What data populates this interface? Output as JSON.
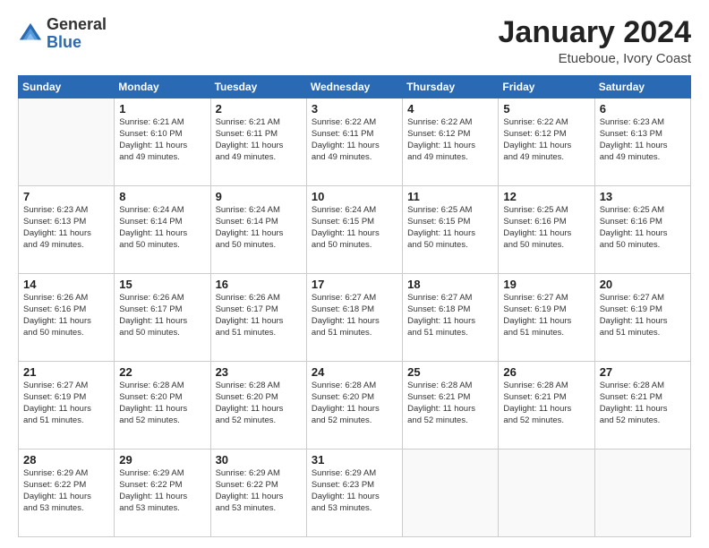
{
  "header": {
    "logo_general": "General",
    "logo_blue": "Blue",
    "month": "January 2024",
    "location": "Etueboue, Ivory Coast"
  },
  "weekdays": [
    "Sunday",
    "Monday",
    "Tuesday",
    "Wednesday",
    "Thursday",
    "Friday",
    "Saturday"
  ],
  "weeks": [
    [
      {
        "day": "",
        "info": ""
      },
      {
        "day": "1",
        "info": "Sunrise: 6:21 AM\nSunset: 6:10 PM\nDaylight: 11 hours\nand 49 minutes."
      },
      {
        "day": "2",
        "info": "Sunrise: 6:21 AM\nSunset: 6:11 PM\nDaylight: 11 hours\nand 49 minutes."
      },
      {
        "day": "3",
        "info": "Sunrise: 6:22 AM\nSunset: 6:11 PM\nDaylight: 11 hours\nand 49 minutes."
      },
      {
        "day": "4",
        "info": "Sunrise: 6:22 AM\nSunset: 6:12 PM\nDaylight: 11 hours\nand 49 minutes."
      },
      {
        "day": "5",
        "info": "Sunrise: 6:22 AM\nSunset: 6:12 PM\nDaylight: 11 hours\nand 49 minutes."
      },
      {
        "day": "6",
        "info": "Sunrise: 6:23 AM\nSunset: 6:13 PM\nDaylight: 11 hours\nand 49 minutes."
      }
    ],
    [
      {
        "day": "7",
        "info": "Sunrise: 6:23 AM\nSunset: 6:13 PM\nDaylight: 11 hours\nand 49 minutes."
      },
      {
        "day": "8",
        "info": "Sunrise: 6:24 AM\nSunset: 6:14 PM\nDaylight: 11 hours\nand 50 minutes."
      },
      {
        "day": "9",
        "info": "Sunrise: 6:24 AM\nSunset: 6:14 PM\nDaylight: 11 hours\nand 50 minutes."
      },
      {
        "day": "10",
        "info": "Sunrise: 6:24 AM\nSunset: 6:15 PM\nDaylight: 11 hours\nand 50 minutes."
      },
      {
        "day": "11",
        "info": "Sunrise: 6:25 AM\nSunset: 6:15 PM\nDaylight: 11 hours\nand 50 minutes."
      },
      {
        "day": "12",
        "info": "Sunrise: 6:25 AM\nSunset: 6:16 PM\nDaylight: 11 hours\nand 50 minutes."
      },
      {
        "day": "13",
        "info": "Sunrise: 6:25 AM\nSunset: 6:16 PM\nDaylight: 11 hours\nand 50 minutes."
      }
    ],
    [
      {
        "day": "14",
        "info": "Sunrise: 6:26 AM\nSunset: 6:16 PM\nDaylight: 11 hours\nand 50 minutes."
      },
      {
        "day": "15",
        "info": "Sunrise: 6:26 AM\nSunset: 6:17 PM\nDaylight: 11 hours\nand 50 minutes."
      },
      {
        "day": "16",
        "info": "Sunrise: 6:26 AM\nSunset: 6:17 PM\nDaylight: 11 hours\nand 51 minutes."
      },
      {
        "day": "17",
        "info": "Sunrise: 6:27 AM\nSunset: 6:18 PM\nDaylight: 11 hours\nand 51 minutes."
      },
      {
        "day": "18",
        "info": "Sunrise: 6:27 AM\nSunset: 6:18 PM\nDaylight: 11 hours\nand 51 minutes."
      },
      {
        "day": "19",
        "info": "Sunrise: 6:27 AM\nSunset: 6:19 PM\nDaylight: 11 hours\nand 51 minutes."
      },
      {
        "day": "20",
        "info": "Sunrise: 6:27 AM\nSunset: 6:19 PM\nDaylight: 11 hours\nand 51 minutes."
      }
    ],
    [
      {
        "day": "21",
        "info": "Sunrise: 6:27 AM\nSunset: 6:19 PM\nDaylight: 11 hours\nand 51 minutes."
      },
      {
        "day": "22",
        "info": "Sunrise: 6:28 AM\nSunset: 6:20 PM\nDaylight: 11 hours\nand 52 minutes."
      },
      {
        "day": "23",
        "info": "Sunrise: 6:28 AM\nSunset: 6:20 PM\nDaylight: 11 hours\nand 52 minutes."
      },
      {
        "day": "24",
        "info": "Sunrise: 6:28 AM\nSunset: 6:20 PM\nDaylight: 11 hours\nand 52 minutes."
      },
      {
        "day": "25",
        "info": "Sunrise: 6:28 AM\nSunset: 6:21 PM\nDaylight: 11 hours\nand 52 minutes."
      },
      {
        "day": "26",
        "info": "Sunrise: 6:28 AM\nSunset: 6:21 PM\nDaylight: 11 hours\nand 52 minutes."
      },
      {
        "day": "27",
        "info": "Sunrise: 6:28 AM\nSunset: 6:21 PM\nDaylight: 11 hours\nand 52 minutes."
      }
    ],
    [
      {
        "day": "28",
        "info": "Sunrise: 6:29 AM\nSunset: 6:22 PM\nDaylight: 11 hours\nand 53 minutes."
      },
      {
        "day": "29",
        "info": "Sunrise: 6:29 AM\nSunset: 6:22 PM\nDaylight: 11 hours\nand 53 minutes."
      },
      {
        "day": "30",
        "info": "Sunrise: 6:29 AM\nSunset: 6:22 PM\nDaylight: 11 hours\nand 53 minutes."
      },
      {
        "day": "31",
        "info": "Sunrise: 6:29 AM\nSunset: 6:23 PM\nDaylight: 11 hours\nand 53 minutes."
      },
      {
        "day": "",
        "info": ""
      },
      {
        "day": "",
        "info": ""
      },
      {
        "day": "",
        "info": ""
      }
    ]
  ]
}
